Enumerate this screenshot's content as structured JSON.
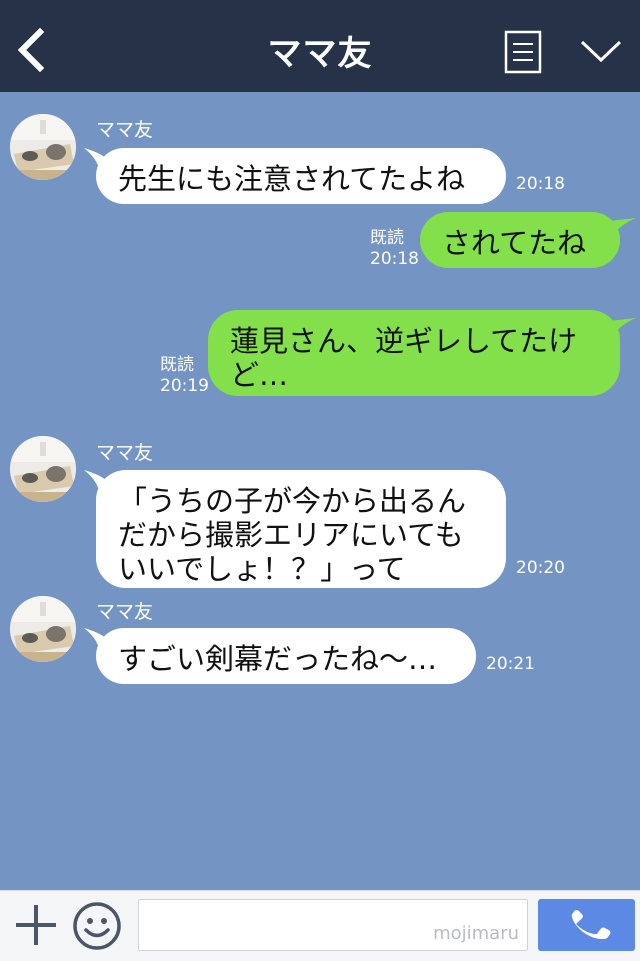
{
  "header": {
    "title": "ママ友",
    "back_icon": "chevron-left-icon",
    "menu_icon": "list-icon",
    "more_icon": "chevron-down-icon"
  },
  "messages": [
    {
      "direction": "in",
      "sender": "ママ友",
      "text": "先生にも注意されてたよね",
      "time": "20:18"
    },
    {
      "direction": "out",
      "read": "既読",
      "text": "されてたね",
      "time": "20:18"
    },
    {
      "direction": "out",
      "read": "既読",
      "text": "蓮見さん、逆ギレしてたけ\nど…",
      "time": "20:19"
    },
    {
      "direction": "in",
      "sender": "ママ友",
      "text": "「うちの子が今から出るん\nだから撮影エリアにいても\nいいでしょ！？」って",
      "time": "20:20"
    },
    {
      "direction": "in",
      "sender": "ママ友",
      "text": "すごい剣幕だったね〜…",
      "time": "20:21"
    }
  ],
  "input_bar": {
    "plus_icon": "plus-icon",
    "emoji_icon": "smiley-icon",
    "watermark": "mojimaru",
    "call_icon": "phone-icon"
  },
  "colors": {
    "background": "#7494c3",
    "header": "#263248",
    "outgoing_bubble": "#84e04a",
    "incoming_bubble": "#ffffff",
    "call_button": "#5b89e3"
  }
}
